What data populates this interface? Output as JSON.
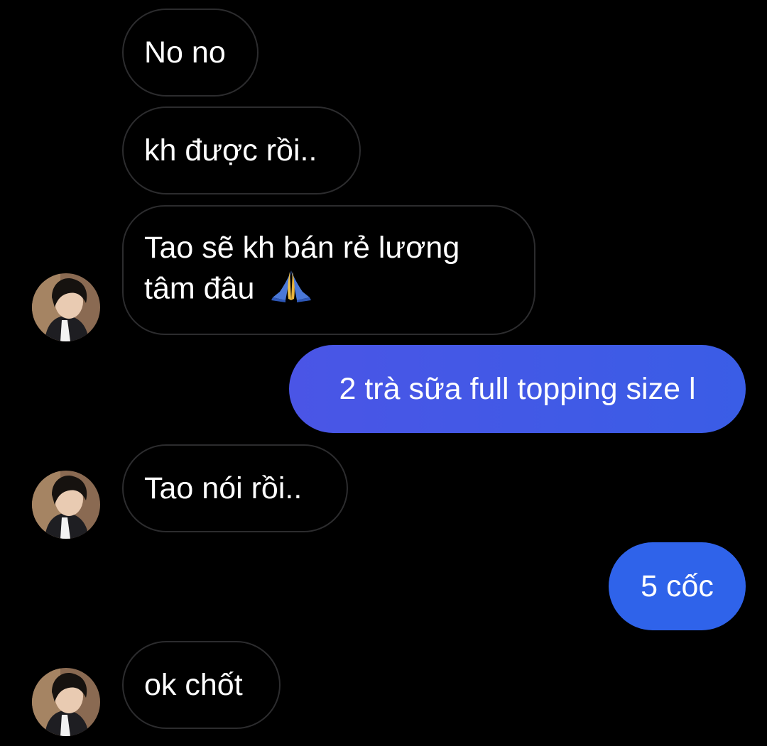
{
  "messages": [
    {
      "id": "m1",
      "direction": "incoming",
      "text": "No no"
    },
    {
      "id": "m2",
      "direction": "incoming",
      "text": "kh được rồi.."
    },
    {
      "id": "m3",
      "direction": "incoming",
      "lines": [
        "Tao sẽ kh bán rẻ lương",
        "tâm đâu"
      ],
      "emoji": "folded-hands-icon"
    },
    {
      "id": "m4",
      "direction": "outgoing",
      "text": "2 trà sữa full topping size l"
    },
    {
      "id": "m5",
      "direction": "incoming",
      "text": "Tao nói rồi.."
    },
    {
      "id": "m6",
      "direction": "outgoing",
      "text": "5 cốc"
    },
    {
      "id": "m7",
      "direction": "incoming",
      "text": "ok chốt"
    }
  ],
  "colors": {
    "background": "#000000",
    "incoming_border": "#2c2c2e",
    "outgoing_purple": "#4a55e6",
    "outgoing_blue": "#2f63ea",
    "text": "#ffffff"
  }
}
